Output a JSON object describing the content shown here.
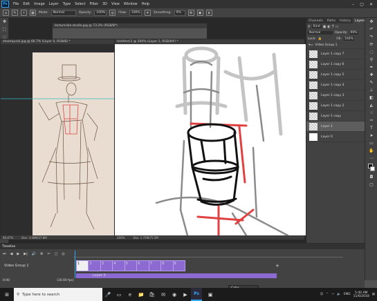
{
  "menubar": {
    "logo": "Ps",
    "items": [
      "File",
      "Edit",
      "Image",
      "Layer",
      "Type",
      "Select",
      "Filter",
      "3D",
      "View",
      "Window",
      "Help"
    ]
  },
  "options": {
    "mode_label": "Mode:",
    "mode_value": "Normal",
    "opacity_label": "Opacity:",
    "opacity_value": "100%",
    "flow_label": "Flow:",
    "flow_value": "100%",
    "smoothing_label": "Smoothing:",
    "smoothing_value": "0%"
  },
  "documents": {
    "doc1_title": "lecture-bla-studio.jpg @ 73.2% (RGB/8*)",
    "doc2_title": "steampunk.jpg @ 66.7% (Layer 0, RGB/8) *",
    "doc2_zoom": "66.67%",
    "doc2_status": "Doc: 3.48M/27.8M",
    "doc3_title": "Untitled-2 @ 200% (Layer 1, RGB/8#) *",
    "doc3_zoom": "200%",
    "doc3_status": "Doc: 1.72M/75.5M"
  },
  "panels": {
    "tabs": [
      "Channels",
      "Paths",
      "History",
      "Layers"
    ],
    "kind_label": "Kind",
    "mode_value": "Normal",
    "opacity_label": "Opacity:",
    "opacity_value": "99%",
    "lock_label": "Lock:",
    "fill_label": "Fill:",
    "fill_value": "100%",
    "group_name": "Video Group 1",
    "layers": [
      {
        "name": "Layer 1 copy 7"
      },
      {
        "name": "Layer 1 copy 6"
      },
      {
        "name": "Layer 1 copy 5"
      },
      {
        "name": "Layer 1 copy 4"
      },
      {
        "name": "Layer 1 copy 3"
      },
      {
        "name": "Layer 1 copy 2"
      },
      {
        "name": "Layer 1 copy"
      },
      {
        "name": "Layer 1"
      },
      {
        "name": "Layer 0"
      }
    ]
  },
  "timeline": {
    "title": "Timeline",
    "track1": "Video Group 1",
    "track2": "Layer 0",
    "time": "0:00",
    "fps": "(30.00 fps)",
    "frames": [
      "1",
      "2",
      "3",
      "4",
      "5",
      "6",
      "7",
      "8",
      "9"
    ]
  },
  "taskbar": {
    "search_placeholder": "Type here to search",
    "time": "5:40 AM",
    "date": "11/6/2018",
    "lang": "ENG"
  },
  "colors": {
    "accent": "#31a8ff",
    "timeline_clip": "#8c6ad1",
    "sketch_red": "#e04040"
  },
  "color_popup": "Color"
}
